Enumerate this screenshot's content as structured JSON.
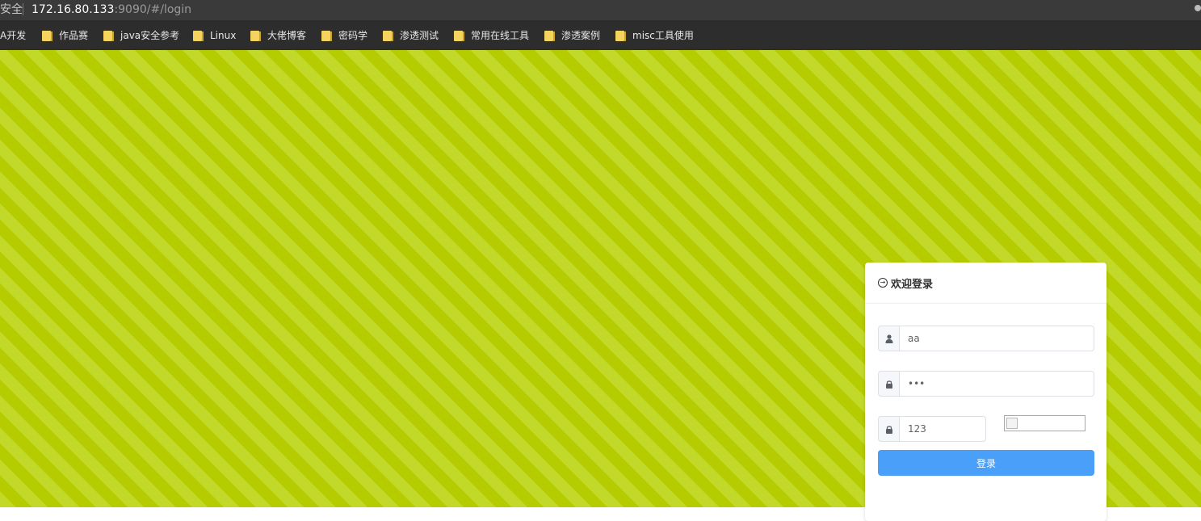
{
  "browser": {
    "security_label": "安全",
    "url_host": "172.16.80.133",
    "url_rest": ":9090/#/login"
  },
  "bookmarks": [
    {
      "label": "A开发",
      "icon": "none"
    },
    {
      "label": "作品赛",
      "icon": "folder-icon"
    },
    {
      "label": "java安全参考",
      "icon": "folder-icon"
    },
    {
      "label": "Linux",
      "icon": "folder-icon"
    },
    {
      "label": "大佬博客",
      "icon": "folder-icon"
    },
    {
      "label": "密码学",
      "icon": "folder-icon"
    },
    {
      "label": "渗透测试",
      "icon": "folder-icon"
    },
    {
      "label": "常用在线工具",
      "icon": "folder-icon"
    },
    {
      "label": "渗透案例",
      "icon": "folder-icon"
    },
    {
      "label": "misc工具使用",
      "icon": "folder-icon"
    }
  ],
  "login": {
    "title": "欢迎登录",
    "username_value": "aa",
    "password_value": "•••",
    "captcha_value": "123",
    "submit_label": "登录",
    "accent_color": "#4a9ff9"
  },
  "colors": {
    "background_stripe_dark": "#b5cc00",
    "background_stripe_light": "#c2d92a"
  }
}
